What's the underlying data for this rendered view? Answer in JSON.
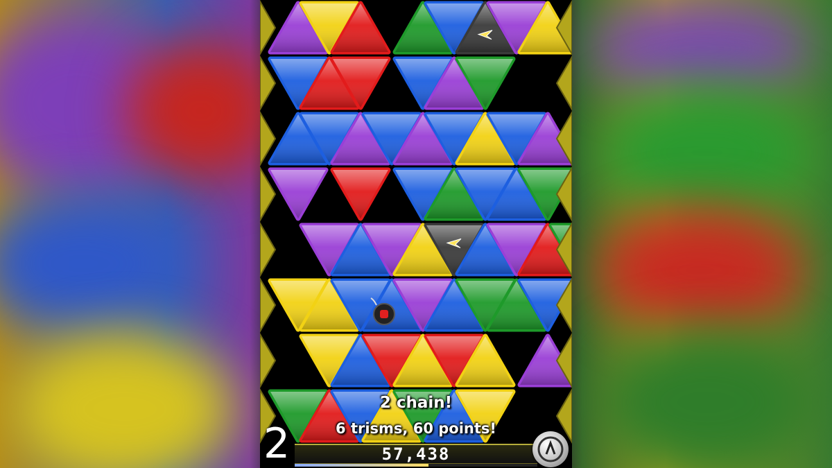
{
  "game": {
    "chain_text": "2 chain!",
    "trisms_text": "6 trisms, 60 points!",
    "level": "2",
    "score": "57,438",
    "level_progress": 0.55
  },
  "colors": {
    "yellow": "#f2d214",
    "red": "#e21b1b",
    "green": "#1e9a2a",
    "blue": "#1d5fe0",
    "purple": "#9a3fd6",
    "black": "#3a3a3a"
  },
  "board": [
    [
      "purple",
      "yellow",
      "red",
      null,
      "green",
      "blue",
      "black",
      "purple",
      "yellow",
      null
    ],
    [
      "blue",
      "red",
      "red",
      null,
      "blue",
      "purple",
      "green",
      null,
      null,
      null
    ],
    [
      "blue",
      "blue",
      "purple",
      "blue",
      "purple",
      "blue",
      "yellow",
      "blue",
      "purple",
      null
    ],
    [
      "purple",
      null,
      "red",
      null,
      "blue",
      "green",
      "blue",
      "blue",
      "green",
      null
    ],
    [
      null,
      "purple",
      "blue",
      "purple",
      "yellow",
      "black",
      "blue",
      "purple",
      "red",
      "green"
    ],
    [
      "yellow",
      "yellow",
      "blue",
      "blue",
      "purple",
      "blue",
      "green",
      "green",
      "blue",
      null
    ],
    [
      null,
      "yellow",
      "blue",
      "red",
      "yellow",
      "red",
      "yellow",
      null,
      "purple",
      null
    ],
    [
      "green",
      "red",
      "blue",
      "yellow",
      "green",
      "blue",
      "yellow",
      null,
      null,
      null
    ]
  ],
  "icons": {
    "star_tile": "star-icon",
    "bomb_tile": "bomb-icon",
    "pause": "pause-icon"
  }
}
